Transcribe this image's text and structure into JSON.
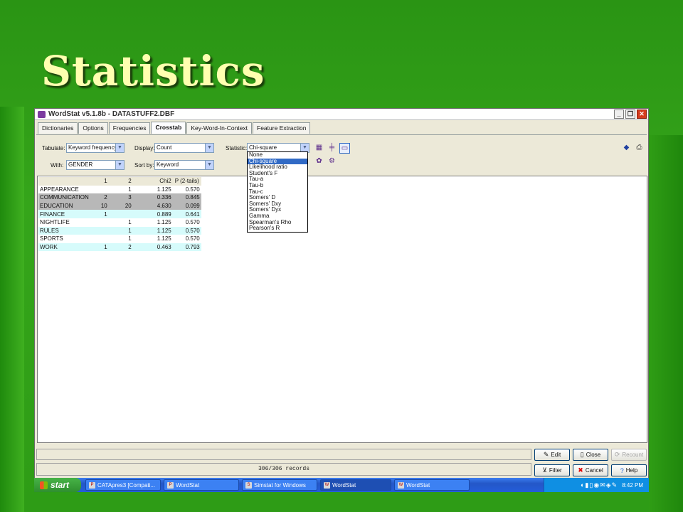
{
  "slide": {
    "title": "Statistics"
  },
  "window": {
    "title": "WordStat v5.1.8b - DATASTUFF2.DBF"
  },
  "tabs": [
    "Dictionaries",
    "Options",
    "Frequencies",
    "Crosstab",
    "Key-Word-In-Context",
    "Feature Extraction"
  ],
  "active_tab": "Crosstab",
  "toolbar": {
    "tabulate_label": "Tabulate:",
    "tabulate_value": "Keyword frequency",
    "with_label": "With:",
    "with_value": "GENDER",
    "display_label": "Display:",
    "display_value": "Count",
    "sortby_label": "Sort by:",
    "sortby_value": "Keyword",
    "statistic_label": "Statistic:",
    "statistic_value": "Chi-square"
  },
  "statistic_options": [
    "None",
    "Chi-square",
    "Likelihood ratio",
    "Student's F",
    "Tau-a",
    "Tau-b",
    "Tau-c",
    "Somers' D",
    "Somers' Dxy",
    "Somers' Dyx",
    "Gamma",
    "Spearman's Rho",
    "Pearson's R"
  ],
  "statistic_selected": "Chi-square",
  "table": {
    "headers": [
      "",
      "1",
      "2",
      "Chi2",
      "P (2-tails)"
    ],
    "rows": [
      {
        "keyword": "APPEARANCE",
        "c1": "",
        "c2": "1",
        "chi2": "1.125",
        "p": "0.570",
        "style": "white"
      },
      {
        "keyword": "COMMUNICATION",
        "c1": "2",
        "c2": "3",
        "chi2": "0.336",
        "p": "0.845",
        "style": "gray"
      },
      {
        "keyword": "EDUCATION",
        "c1": "10",
        "c2": "20",
        "chi2": "4.630",
        "p": "0.099",
        "style": "gray"
      },
      {
        "keyword": "FINANCE",
        "c1": "1",
        "c2": "",
        "chi2": "0.889",
        "p": "0.641",
        "style": "cyan"
      },
      {
        "keyword": "NIGHTLIFE",
        "c1": "",
        "c2": "1",
        "chi2": "1.125",
        "p": "0.570",
        "style": "white"
      },
      {
        "keyword": "RULES",
        "c1": "",
        "c2": "1",
        "chi2": "1.125",
        "p": "0.570",
        "style": "cyan"
      },
      {
        "keyword": "SPORTS",
        "c1": "",
        "c2": "1",
        "chi2": "1.125",
        "p": "0.570",
        "style": "white"
      },
      {
        "keyword": "WORK",
        "c1": "1",
        "c2": "2",
        "chi2": "0.463",
        "p": "0.793",
        "style": "cyan"
      }
    ]
  },
  "status": {
    "records": "306/306 records"
  },
  "buttons": {
    "edit": "Edit",
    "close": "Close",
    "recount": "Recount",
    "filter": "Filter",
    "cancel": "Cancel",
    "help": "Help"
  },
  "taskbar": {
    "start": "start",
    "items": [
      "CATApres3 [Compati...",
      "WordStat",
      "Simstat for Windows",
      "WordStat",
      "WordStat"
    ],
    "clock": "8:42 PM"
  }
}
